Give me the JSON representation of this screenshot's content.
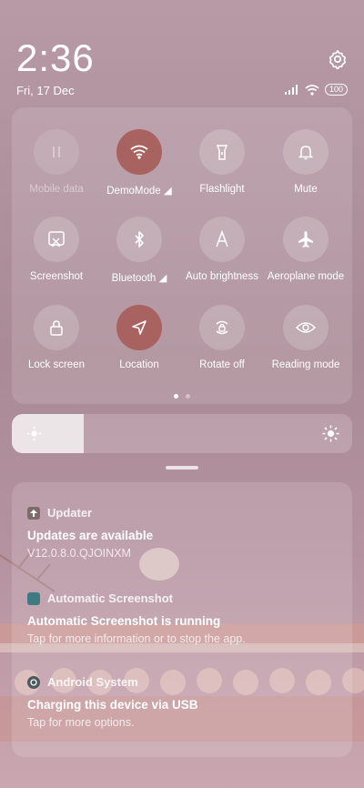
{
  "status": {
    "time": "2:36",
    "date": "Fri, 17 Dec",
    "battery": "100"
  },
  "quick_settings": [
    {
      "label": "Mobile data",
      "icon": "mobile-data-icon",
      "state": "disabled"
    },
    {
      "label": "DemoMode ◢",
      "icon": "wifi-icon",
      "state": "active"
    },
    {
      "label": "Flashlight",
      "icon": "flashlight-icon",
      "state": "off"
    },
    {
      "label": "Mute",
      "icon": "bell-icon",
      "state": "off"
    },
    {
      "label": "Screenshot",
      "icon": "screenshot-icon",
      "state": "off"
    },
    {
      "label": "Bluetooth ◢",
      "icon": "bluetooth-icon",
      "state": "off"
    },
    {
      "label": "Auto brightness",
      "icon": "auto-brightness-icon",
      "state": "off"
    },
    {
      "label": "Aeroplane mode",
      "icon": "airplane-icon",
      "state": "off"
    },
    {
      "label": "Lock screen",
      "icon": "lock-icon",
      "state": "off"
    },
    {
      "label": "Location",
      "icon": "location-icon",
      "state": "active"
    },
    {
      "label": "Rotate off",
      "icon": "rotate-lock-icon",
      "state": "off"
    },
    {
      "label": "Reading mode",
      "icon": "eye-icon",
      "state": "off"
    }
  ],
  "brightness_level": 0.21,
  "page_indicator": {
    "pages": 2,
    "current": 1
  },
  "notifications": [
    {
      "app": "Updater",
      "title": "Updates are available",
      "body": "V12.0.8.0.QJOINXM",
      "icon_color": "#7e6b6b"
    },
    {
      "app": "Automatic Screenshot",
      "title": "Automatic Screenshot is running",
      "body": "Tap for more information or to stop the app.",
      "icon_color": "#3e7a7f"
    },
    {
      "app": "Android System",
      "title": "Charging this device via USB",
      "body": "Tap for more options.",
      "icon_color": "#4a5a5e"
    }
  ],
  "colors": {
    "active_tile": "#a8625f"
  }
}
